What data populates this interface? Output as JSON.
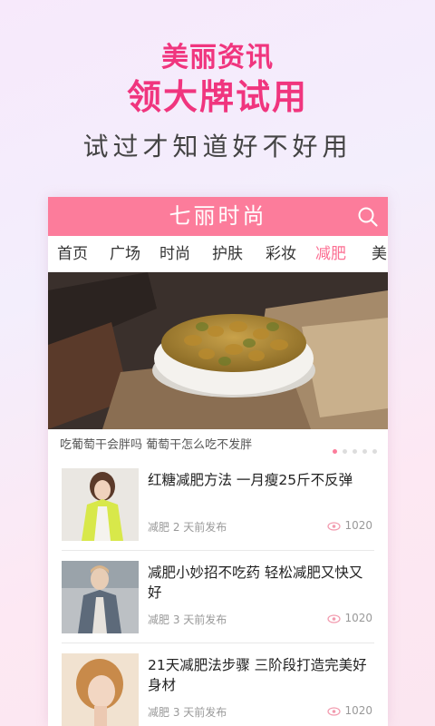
{
  "promo": {
    "line1": "美丽资讯",
    "line2": "领大牌试用",
    "line3": "试过才知道好不好用"
  },
  "app": {
    "title": "七丽时尚",
    "accent_color": "#fc7c9b",
    "search_icon": "search-icon"
  },
  "tabs": [
    {
      "label": "首页"
    },
    {
      "label": "广场"
    },
    {
      "label": "时尚"
    },
    {
      "label": "护肤"
    },
    {
      "label": "彩妆"
    },
    {
      "label": "减肥",
      "active": true
    },
    {
      "label": "美"
    }
  ],
  "banner": {
    "caption": "吃葡萄干会胖吗 葡萄干怎么吃不发胖",
    "slide_count": 5,
    "active_slide": 1
  },
  "articles": [
    {
      "title": "红糖减肥方法 一月瘦25斤不反弹",
      "category": "减肥",
      "time": "2 天前发布",
      "views": "1020"
    },
    {
      "title": "减肥小妙招不吃药 轻松减肥又快又好",
      "category": "减肥",
      "time": "3 天前发布",
      "views": "1020"
    },
    {
      "title": "21天减肥法步骤 三阶段打造完美好身材",
      "category": "减肥",
      "time": "3 天前发布",
      "views": "1020"
    }
  ]
}
